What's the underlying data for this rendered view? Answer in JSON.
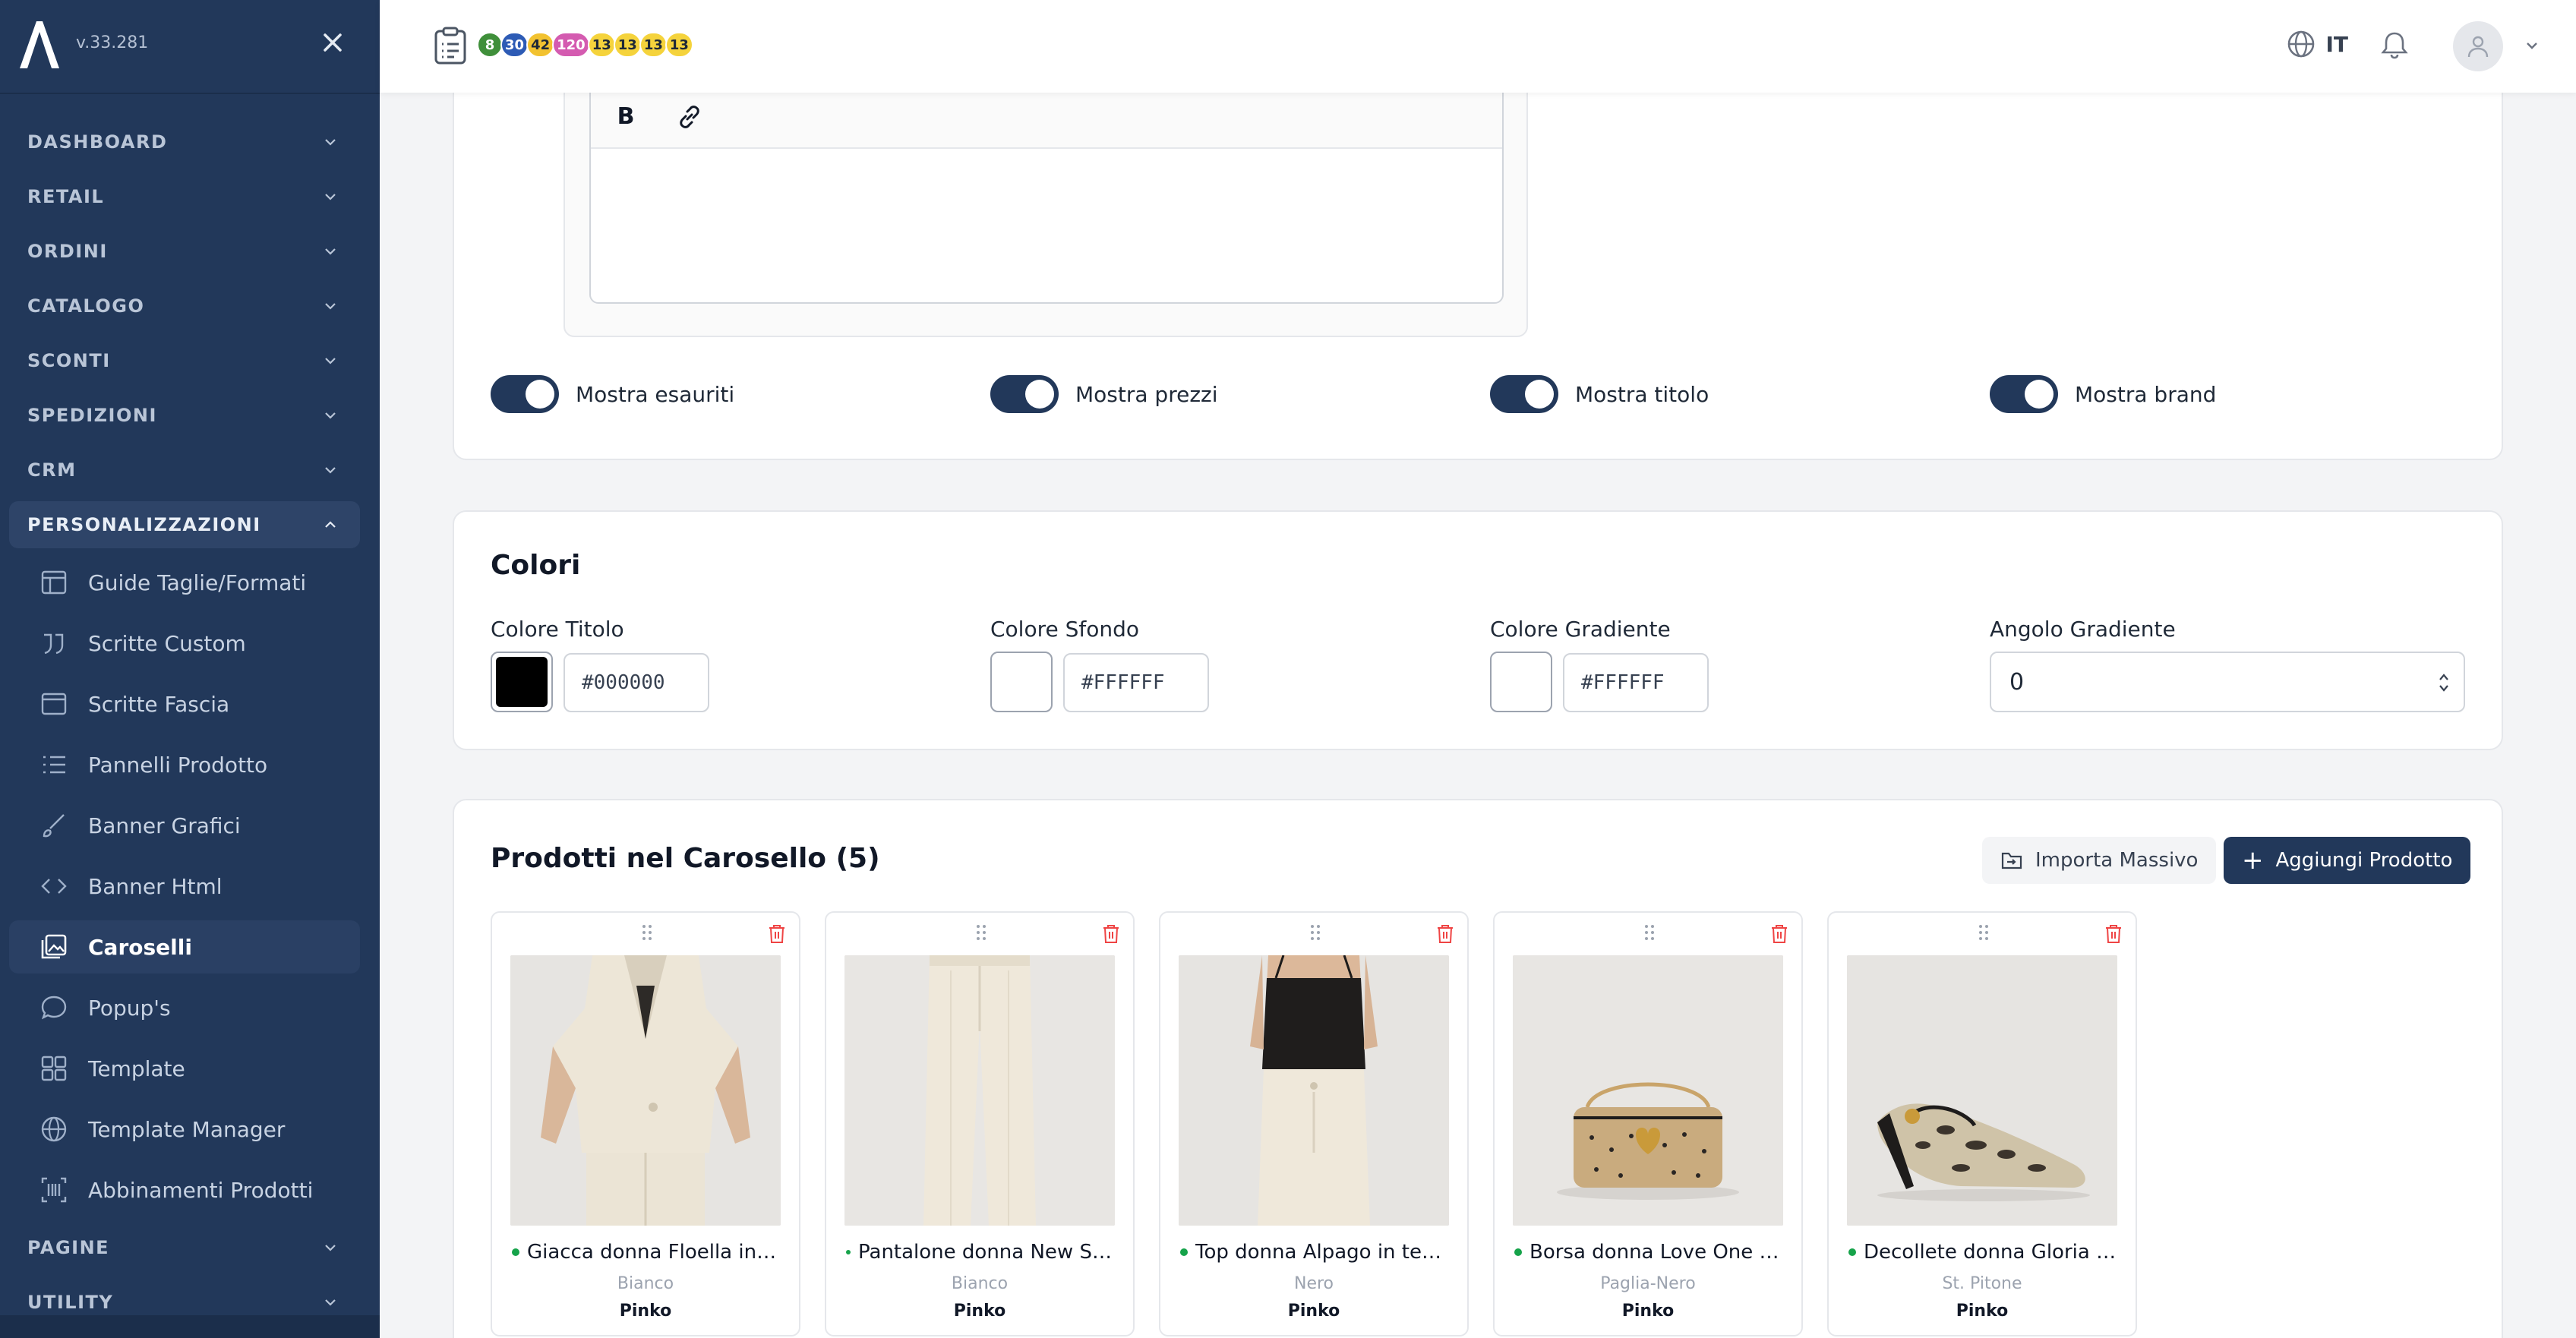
{
  "app": {
    "version": "v.33.281"
  },
  "sidebar": {
    "sections": [
      {
        "label": "DASHBOARD"
      },
      {
        "label": "RETAIL"
      },
      {
        "label": "ORDINI"
      },
      {
        "label": "CATALOGO"
      },
      {
        "label": "SCONTI"
      },
      {
        "label": "SPEDIZIONI"
      },
      {
        "label": "CRM"
      },
      {
        "label": "PERSONALIZZAZIONI"
      }
    ],
    "personalizzazioni_items": [
      {
        "label": "Guide Taglie/Formati",
        "icon": "table-icon"
      },
      {
        "label": "Scritte Custom",
        "icon": "quote-icon"
      },
      {
        "label": "Scritte Fascia",
        "icon": "window-icon"
      },
      {
        "label": "Pannelli Prodotto",
        "icon": "list-icon"
      },
      {
        "label": "Banner Grafici",
        "icon": "brush-icon"
      },
      {
        "label": "Banner Html",
        "icon": "code-icon"
      },
      {
        "label": "Caroselli",
        "icon": "images-icon"
      },
      {
        "label": "Popup's",
        "icon": "chat-bubble-icon"
      },
      {
        "label": "Template",
        "icon": "grid-icon"
      },
      {
        "label": "Template Manager",
        "icon": "globe-icon"
      },
      {
        "label": "Abbinamenti Prodotti",
        "icon": "barcode-icon"
      }
    ],
    "bottom_sections": [
      {
        "label": "PAGINE"
      },
      {
        "label": "UTILITY"
      }
    ],
    "active_item": "Caroselli",
    "colors": {
      "bg": "#22385a",
      "active": "#2a4064"
    }
  },
  "topbar": {
    "badges": [
      {
        "value": "8",
        "color": "#3f8f3a",
        "text_color": "#ffffff"
      },
      {
        "value": "30",
        "color": "#2d5bb5",
        "text_color": "#ffffff"
      },
      {
        "value": "42",
        "color": "#f2c230",
        "text_color": "#1f2937"
      },
      {
        "value": "120",
        "color": "#d45bb0",
        "text_color": "#ffffff"
      },
      {
        "value": "13",
        "color": "#f5d33c",
        "text_color": "#1f2937"
      },
      {
        "value": "13",
        "color": "#f5d33c",
        "text_color": "#1f2937"
      },
      {
        "value": "13",
        "color": "#f5d33c",
        "text_color": "#1f2937"
      },
      {
        "value": "13",
        "color": "#f5d33c",
        "text_color": "#1f2937"
      }
    ],
    "language": "IT"
  },
  "display_options": {
    "toggles": [
      {
        "label": "Mostra esauriti",
        "on": true
      },
      {
        "label": "Mostra prezzi",
        "on": true
      },
      {
        "label": "Mostra titolo",
        "on": true
      },
      {
        "label": "Mostra brand",
        "on": true
      }
    ]
  },
  "colors_section": {
    "title": "Colori",
    "fields": [
      {
        "label": "Colore Titolo",
        "value": "#000000",
        "swatch": "#000000"
      },
      {
        "label": "Colore Sfondo",
        "value": "#FFFFFF",
        "swatch": "#ffffff"
      },
      {
        "label": "Colore Gradiente",
        "value": "#FFFFFF",
        "swatch": "#ffffff"
      }
    ],
    "angle": {
      "label": "Angolo Gradiente",
      "value": "0"
    }
  },
  "products_section": {
    "title": "Prodotti nel Carosello (5)",
    "import_label": "Importa Massivo",
    "add_label": "Aggiungi Prodotto",
    "products": [
      {
        "name": "Giacca donna Floella in f...",
        "color": "Bianco",
        "brand": "Pinko",
        "image": "cream-jacket"
      },
      {
        "name": "Pantalone donna New Se...",
        "color": "Bianco",
        "brand": "Pinko",
        "image": "cream-trousers"
      },
      {
        "name": "Top donna Alpago in tess...",
        "color": "Nero",
        "brand": "Pinko",
        "image": "black-top"
      },
      {
        "name": "Borsa donna Love One M...",
        "color": "Paglia-Nero",
        "brand": "Pinko",
        "image": "straw-bag"
      },
      {
        "name": "Decollete donna Gloria i...",
        "color": "St. Pitone",
        "brand": "Pinko",
        "image": "python-pump"
      }
    ]
  }
}
